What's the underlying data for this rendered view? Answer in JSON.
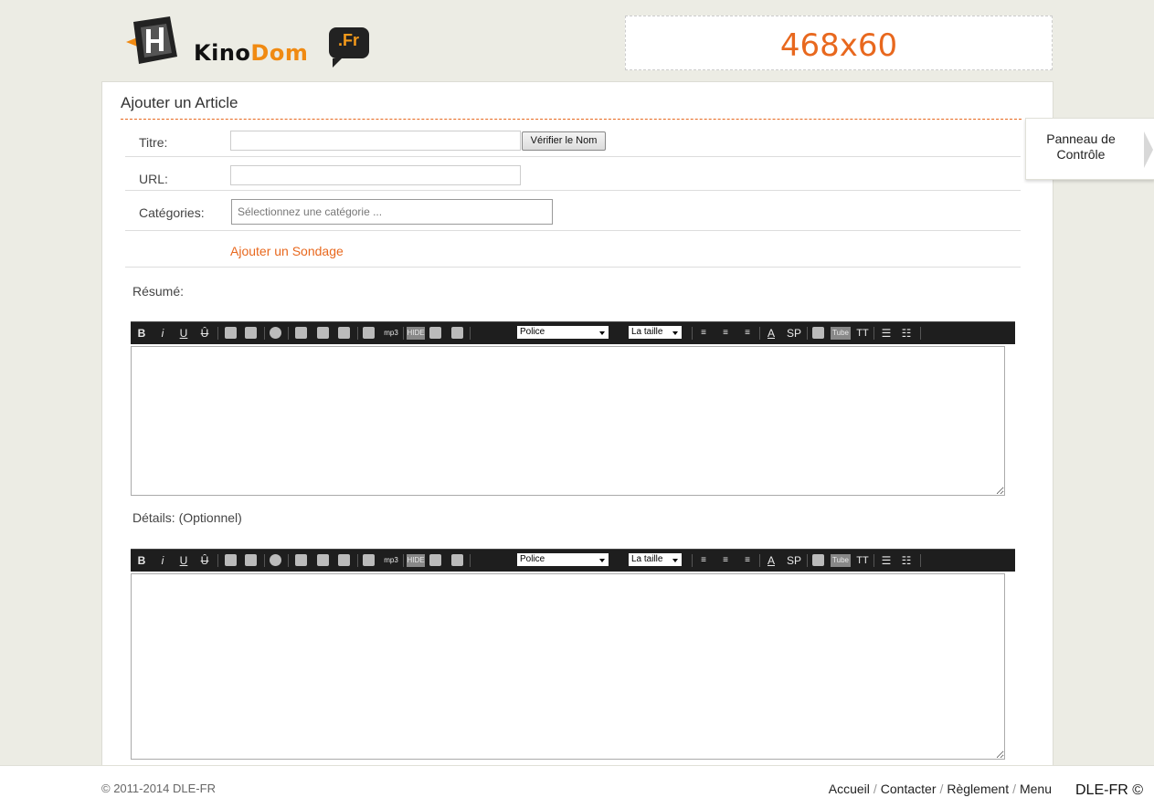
{
  "header": {
    "logo_text_dark": "Kino",
    "logo_text_orange": "Dom",
    "logo_badge": ".Fr",
    "banner_label": "468x60"
  },
  "form": {
    "title": "Ajouter un Article",
    "fields": {
      "titre_label": "Titre:",
      "titre_value": "",
      "check_button": "Vérifier le Nom",
      "url_label": "URL:",
      "url_value": "",
      "categories_label": "Catégories:",
      "categories_placeholder": "Sélectionnez une catégorie ..."
    },
    "add_poll": "Ajouter un Sondage",
    "summary_label": "Résumé:",
    "details_label": "Détails: (Optionnel)",
    "toolbar": {
      "bold": "B",
      "italic": "i",
      "underline": "U",
      "strike": "Ȗ",
      "mp3": "mp3",
      "hide": "HIDE",
      "font_select": "Police",
      "size_select": "La taille",
      "color": "A",
      "spoiler": "SP",
      "tube": "Tube",
      "typo": "TT"
    }
  },
  "side_tab": {
    "label": "Panneau de Contrôle"
  },
  "footer": {
    "copyright": "© 2011-2014 DLE-FR",
    "nav": [
      "Accueil",
      "Contacter",
      "Règlement",
      "Menu"
    ],
    "brand": "DLE-FR ©"
  },
  "colors": {
    "accent": "#e8681e",
    "logo_orange": "#f08a12",
    "toolbar": "#1e1e1e"
  }
}
